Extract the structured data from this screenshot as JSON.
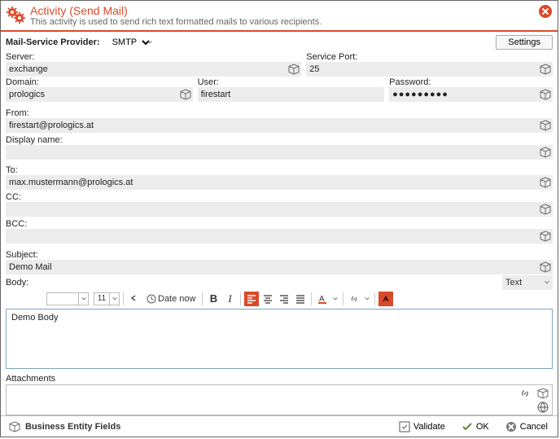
{
  "header": {
    "title": "Activity (Send Mail)",
    "subtitle": "This activity is used to send rich text formatted mails to various recipients."
  },
  "provider": {
    "label": "Mail-Service Provider:",
    "value": "SMTP",
    "settings": "Settings"
  },
  "server": {
    "label": "Server:",
    "value": "exchange"
  },
  "port": {
    "label": "Service Port:",
    "value": "25"
  },
  "domain": {
    "label": "Domain:",
    "value": "prologics"
  },
  "user": {
    "label": "User:",
    "value": "firestart"
  },
  "password": {
    "label": "Password:",
    "value": "●●●●●●●●●"
  },
  "from": {
    "label": "From:",
    "value": "firestart@prologics.at"
  },
  "display": {
    "label": "Display name:",
    "value": ""
  },
  "to": {
    "label": "To:",
    "value": "max.mustermann@prologics.at"
  },
  "cc": {
    "label": "CC:",
    "value": ""
  },
  "bcc": {
    "label": "BCC:",
    "value": ""
  },
  "subject": {
    "label": "Subject:",
    "value": "Demo Mail"
  },
  "body": {
    "label": "Body:",
    "format": "Text",
    "content": "Demo Body"
  },
  "toolbar": {
    "fontsize": "11",
    "datenow": "Date now"
  },
  "attachments": {
    "label": "Attachments"
  },
  "footer": {
    "entity": "Business Entity Fields",
    "validate": "Validate",
    "ok": "OK",
    "cancel": "Cancel"
  }
}
